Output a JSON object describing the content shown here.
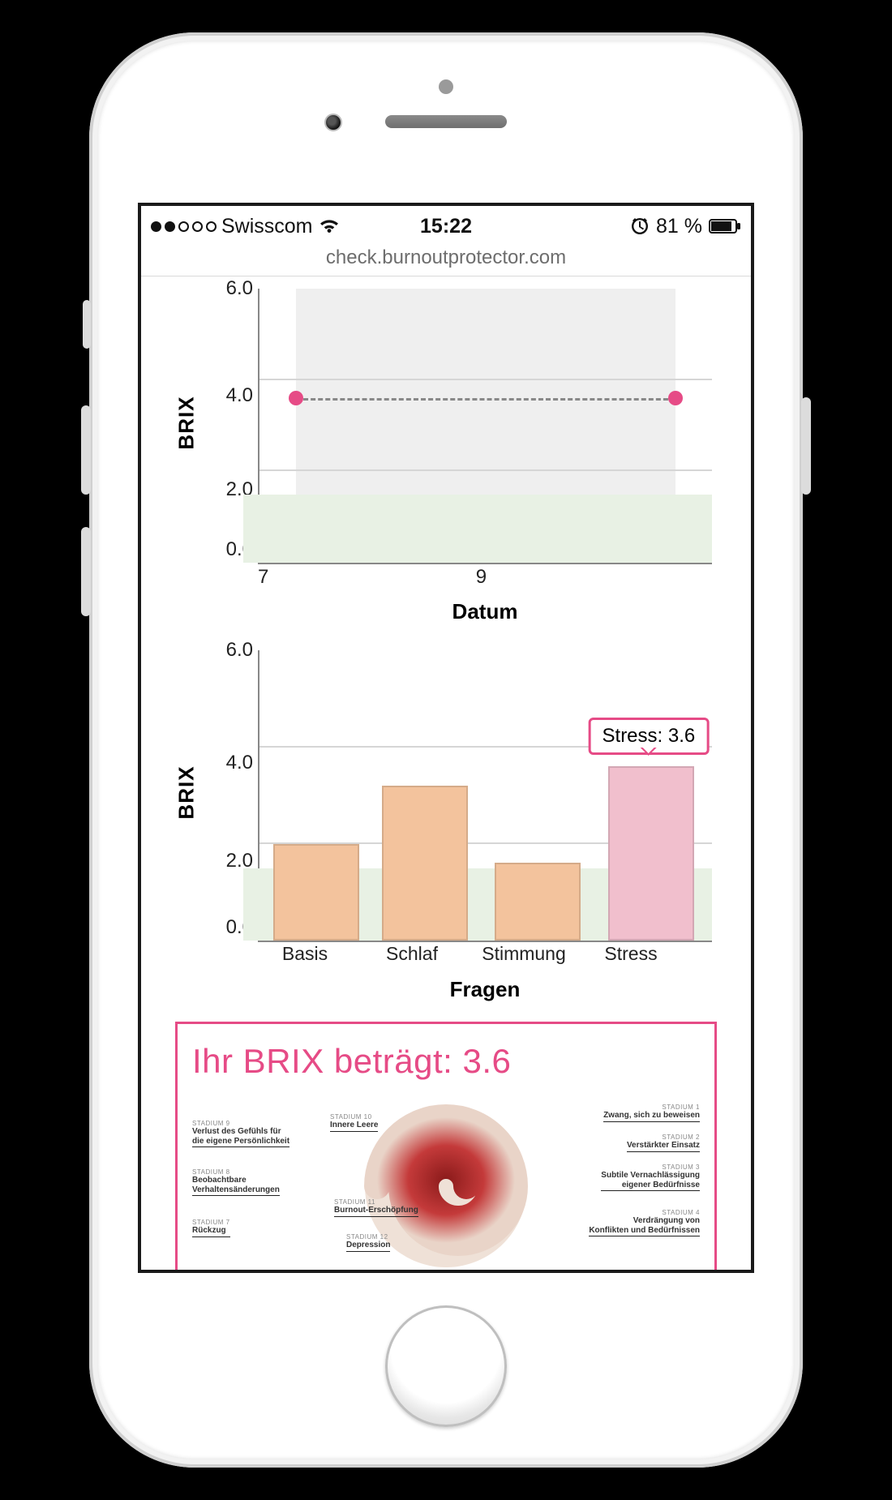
{
  "status": {
    "carrier": "Swisscom",
    "time": "15:22",
    "battery_pct": "81 %"
  },
  "browser": {
    "url": "check.burnoutprotector.com"
  },
  "chart1": {
    "ylabel": "BRIX",
    "xlabel": "Datum",
    "yticks": [
      "0.0",
      "2.0",
      "4.0",
      "6.0"
    ],
    "xticks": [
      "7",
      "9"
    ]
  },
  "chart2": {
    "ylabel": "BRIX",
    "xlabel": "Fragen",
    "yticks": [
      "0.0",
      "2.0",
      "4.0",
      "6.0"
    ],
    "xticks": [
      "Basis",
      "Schlaf",
      "Stimmung",
      "Stress"
    ],
    "tooltip": "Stress: 3.6"
  },
  "result": {
    "title": "Ihr BRIX beträgt: 3.6",
    "stages_left": [
      {
        "stad": "STADIUM 9",
        "t1": "Verlust des Gefühls für",
        "t2": "die eigene Persönlichkeit"
      },
      {
        "stad": "STADIUM 8",
        "t1": "Beobachtbare",
        "t2": "Verhaltensänderungen"
      },
      {
        "stad": "STADIUM 7",
        "t1": "Rückzug",
        "t2": ""
      }
    ],
    "stages_center": [
      {
        "stad": "STADIUM 10",
        "t1": "Innere Leere"
      },
      {
        "stad": "STADIUM 11",
        "t1": "Burnout-Erschöpfung"
      },
      {
        "stad": "STADIUM 12",
        "t1": "Depression"
      }
    ],
    "stages_right": [
      {
        "stad": "STADIUM 1",
        "t1": "Zwang, sich zu beweisen"
      },
      {
        "stad": "STADIUM 2",
        "t1": "Verstärkter Einsatz"
      },
      {
        "stad": "STADIUM 3",
        "t1": "Subtile Vernachlässigung",
        "t2": "eigener Bedürfnisse"
      },
      {
        "stad": "STADIUM 4",
        "t1": "Verdrängung von",
        "t2": "Konflikten und Bedürfnissen"
      }
    ]
  },
  "chart_data": [
    {
      "type": "line",
      "title": "",
      "xlabel": "Datum",
      "ylabel": "BRIX",
      "ylim": [
        0,
        6
      ],
      "yticks": [
        0,
        2,
        4,
        6
      ],
      "x": [
        7.3,
        10.5
      ],
      "values": [
        3.6,
        3.6
      ],
      "band": {
        "from": 0,
        "to": 1.5,
        "color": "#e8f1e4"
      }
    },
    {
      "type": "bar",
      "title": "",
      "xlabel": "Fragen",
      "ylabel": "BRIX",
      "ylim": [
        0,
        6
      ],
      "yticks": [
        0,
        2,
        4,
        6
      ],
      "categories": [
        "Basis",
        "Schlaf",
        "Stimmung",
        "Stress"
      ],
      "values": [
        2.0,
        3.2,
        1.6,
        3.6
      ],
      "highlight": {
        "category": "Stress",
        "label": "Stress: 3.6"
      },
      "band": {
        "from": 0,
        "to": 1.5,
        "color": "#e8f1e4"
      }
    }
  ]
}
